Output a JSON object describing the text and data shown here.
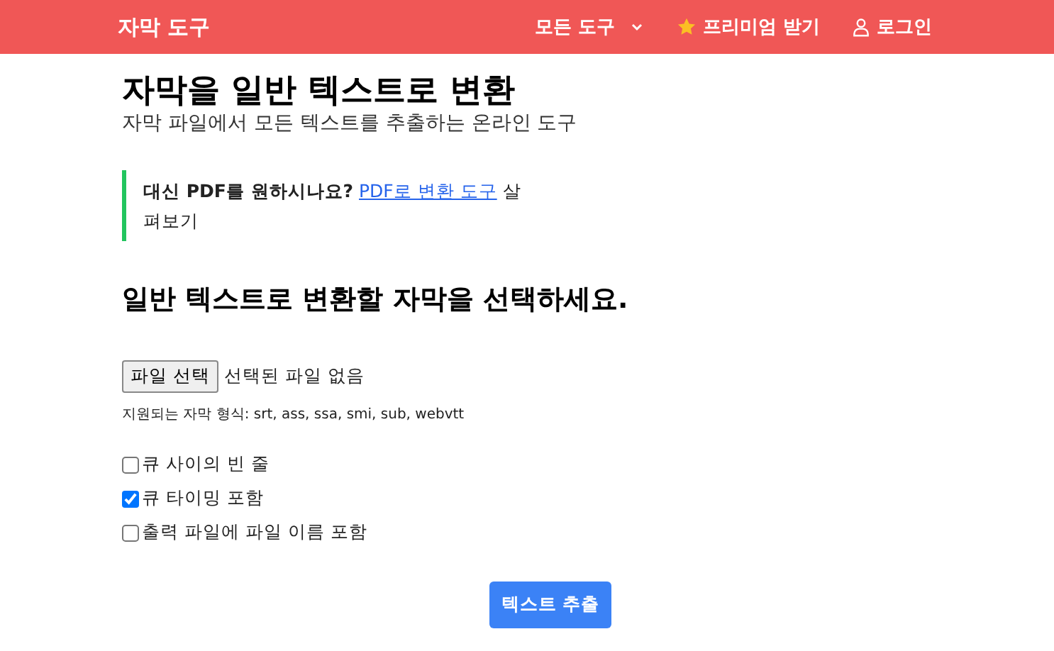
{
  "navbar": {
    "brand": "자막 도구",
    "items": [
      {
        "kind": "dropdown",
        "label": "모든 도구"
      },
      {
        "kind": "star",
        "label": "프리미엄 받기"
      },
      {
        "kind": "user",
        "label": "로그인"
      }
    ]
  },
  "header": {
    "title": "자막을 일반 텍스트로 변환",
    "subtitle": "자막 파일에서 모든 텍스트를 추출하는 온라인 도구"
  },
  "callout": {
    "lead": "**대신 PDF를 원하시나요?**",
    "link": "PDF로 변환 도구",
    "tail": "살펴보기"
  },
  "form": {
    "heading": "일반 텍스트로 변환할 자막을 선택하세요.",
    "file_button": "파일 선택",
    "file_status": "선택된 파일 없음",
    "formats": "지원되는 자막 형식: srt, ass, ssa, smi, sub, webvtt",
    "options": [
      {
        "label": "큐 사이의 빈 줄",
        "checked": false
      },
      {
        "label": "큐 타이밍 포함",
        "checked": true
      },
      {
        "label": "출력 파일에 파일 이름 포함",
        "checked": false
      }
    ],
    "submit": "텍스트 추출"
  }
}
